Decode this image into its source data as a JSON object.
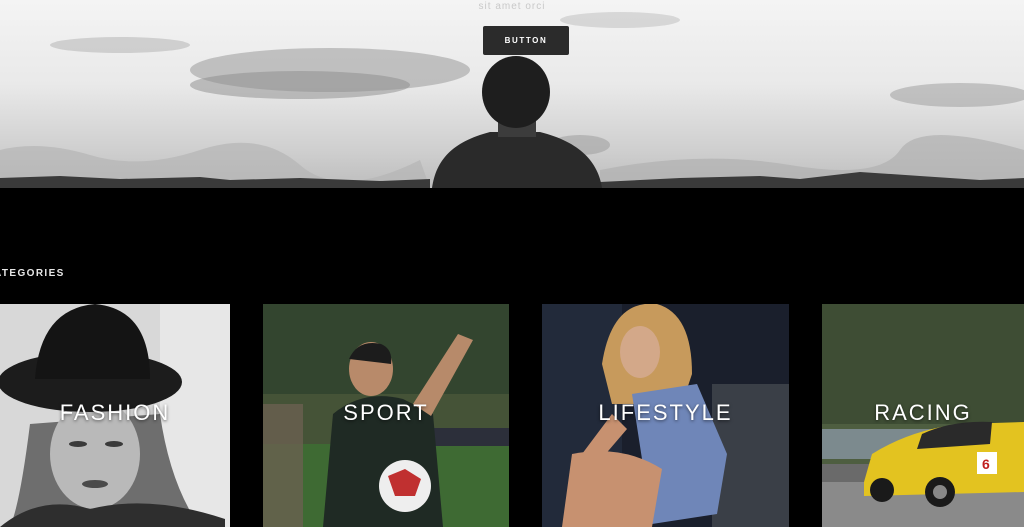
{
  "hero": {
    "subtitle": "sit amet orci",
    "button_label": "BUTTON"
  },
  "categories": {
    "heading": "ATEGORIES",
    "items": [
      {
        "label": "FASHION"
      },
      {
        "label": "SPORT"
      },
      {
        "label": "LIFESTYLE"
      },
      {
        "label": "RACING"
      }
    ]
  },
  "colors": {
    "page_background": "#000000",
    "button_background": "#2b2b2b",
    "label_text": "#ffffff"
  }
}
